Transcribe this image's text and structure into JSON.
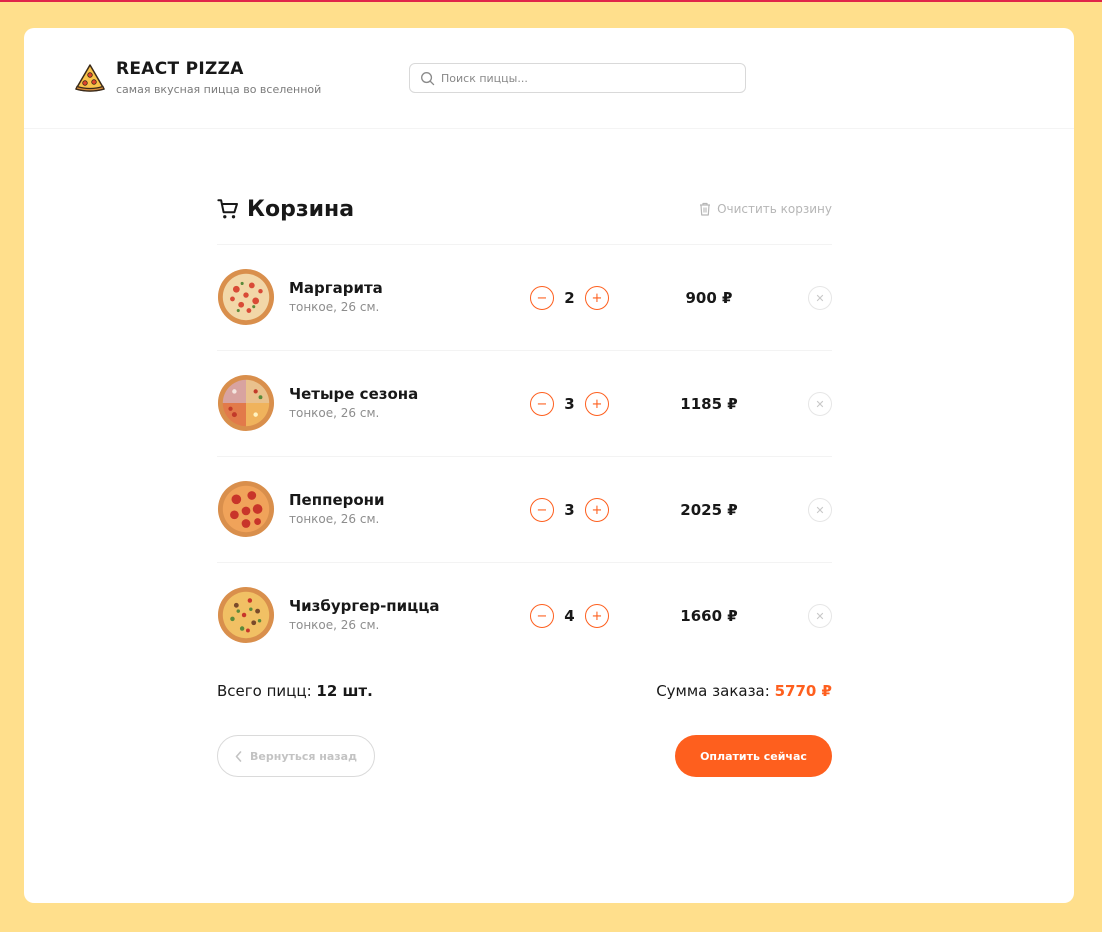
{
  "header": {
    "title": "REACT PIZZA",
    "subtitle": "самая вкусная пицца во вселенной",
    "search_placeholder": "Поиск пиццы..."
  },
  "cart": {
    "title": "Корзина",
    "clear_label": "Очистить корзину",
    "items": [
      {
        "name": "Маргарита",
        "desc": "тонкое, 26 см.",
        "count": "2",
        "price": "900 ₽",
        "image": "margherita"
      },
      {
        "name": "Четыре сезона",
        "desc": "тонкое, 26 см.",
        "count": "3",
        "price": "1185 ₽",
        "image": "four-seasons"
      },
      {
        "name": "Пепперони",
        "desc": "тонкое, 26 см.",
        "count": "3",
        "price": "2025 ₽",
        "image": "pepperoni"
      },
      {
        "name": "Чизбургер-пицца",
        "desc": "тонкое, 26 см.",
        "count": "4",
        "price": "1660 ₽",
        "image": "cheeseburger"
      }
    ],
    "total_count_label": "Всего пицц:",
    "total_count_value": "12 шт.",
    "total_sum_label": "Сумма заказа:",
    "total_sum_value": "5770 ₽",
    "back_label": "Вернуться назад",
    "pay_label": "Оплатить сейчас"
  },
  "colors": {
    "accent": "#fe5f1e",
    "background": "#FFDF8C",
    "top_line": "#e0244a"
  },
  "icons": {
    "logo": "pizza-slice-icon",
    "search": "search-icon",
    "cart": "cart-icon",
    "clear": "trash-icon",
    "minus": "minus-icon",
    "plus": "plus-icon",
    "remove": "close-icon",
    "back": "chevron-left-icon"
  }
}
